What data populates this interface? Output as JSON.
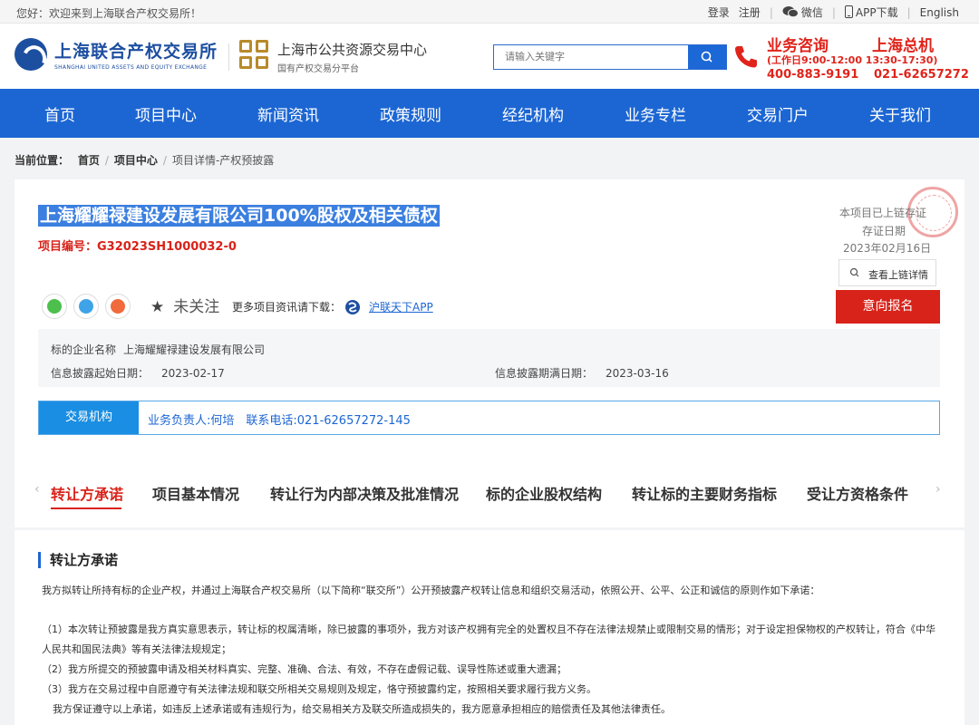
{
  "topbar": {
    "welcome": "您好：欢迎来到上海联合产权交易所！",
    "login": "登录",
    "register": "注册",
    "wechat": "微信",
    "app": "APP下载",
    "english": "English"
  },
  "header": {
    "logo_cn": "上海联合产权交易所",
    "logo_en": "SHANGHAI UNITED ASSETS AND EQUITY EXCHANGE",
    "center_title": "上海市公共资源交易中心",
    "center_subtitle": "国有产权交易分平台",
    "search_placeholder": "请输入关键字",
    "hotline_label1": "业务咨询",
    "hotline_label2": "上海总机",
    "hotline_hours": "(工作日9:00-12:00 13:30-17:30)",
    "hotline_num1": "400-883-9191",
    "hotline_num2": "021-62657272"
  },
  "nav": {
    "items": [
      "首页",
      "项目中心",
      "新闻资讯",
      "政策规则",
      "经纪机构",
      "业务专栏",
      "交易门户",
      "关于我们"
    ]
  },
  "breadcrumb": {
    "label": "当前位置：",
    "home": "首页",
    "section": "项目中心",
    "current": "项目详情-产权预披露"
  },
  "project": {
    "title": "上海耀耀禄建设发展有限公司100%股权及相关债权",
    "code": "项目编号：G32023SH1000032-0",
    "chain_status": "本项目已上链存证",
    "chain_date_label": "存证日期",
    "chain_date": "2023年02月16日",
    "view_chain": "查看上链详情",
    "sign_up": "意向报名",
    "follow": "未关注",
    "more_app": "更多项目资讯请下载：",
    "app_link": "沪联天下APP",
    "company_label": "标的企业名称",
    "company_name": "上海耀耀禄建设发展有限公司",
    "start_label": "信息披露起始日期：",
    "start_date": "2023-02-17",
    "end_label": "信息披露期满日期：",
    "end_date": "2023-03-16",
    "agency_tag": "交易机构",
    "agency_text": "业务负责人:何培　联系电话:021-62657272-145"
  },
  "tabs": [
    "转让方承诺",
    "项目基本情况",
    "转让行为内部决策及批准情况",
    "标的企业股权结构",
    "转让标的主要财务指标",
    "受让方资格条件"
  ],
  "content": {
    "title": "转让方承诺",
    "p1": "我方拟转让所持有标的企业产权，并通过上海联合产权交易所（以下简称“联交所”）公开预披露产权转让信息和组织交易活动，依照公开、公平、公正和诚信的原则作如下承诺：",
    "p2": "（1）本次转让预披露是我方真实意思表示，转让标的权属清晰，除已披露的事项外，我方对该产权拥有完全的处置权且不存在法律法规禁止或限制交易的情形；对于设定担保物权的产权转让，符合《中华人民共和国民法典》等有关法律法规规定；",
    "p3": "（2）我方所提交的预披露申请及相关材料真实、完整、准确、合法、有效，不存在虚假记载、误导性陈述或重大遗漏；",
    "p4": "（3）我方在交易过程中自愿遵守有关法律法规和联交所相关交易规则及规定，恪守预披露约定，按照相关要求履行我方义务。",
    "p5": "我方保证遵守以上承诺，如违反上述承诺或有违规行为，给交易相关方及联交所造成损失的，我方愿意承担相应的赔偿责任及其他法律责任。"
  },
  "colors": {
    "brand_blue": "#1c66d3",
    "accent_red": "#d8231a",
    "agency_blue": "#1a8ee2"
  }
}
